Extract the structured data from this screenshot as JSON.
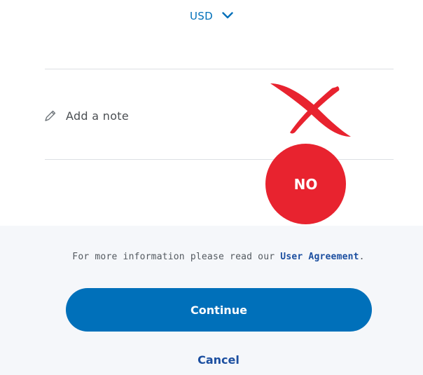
{
  "currency": {
    "code": "USD",
    "dropdown_icon": "chevron-down-icon"
  },
  "note": {
    "icon": "pencil-icon",
    "placeholder": "Add a note"
  },
  "annotation": {
    "mark_icon": "red-x-mark",
    "badge_label": "NO",
    "color": "#e8232f"
  },
  "info": {
    "prefix": "For more information please read our ",
    "link": "User Agreement",
    "suffix": "."
  },
  "actions": {
    "continue_label": "Continue",
    "cancel_label": "Cancel"
  },
  "colors": {
    "brand_blue": "#0070ba",
    "link_blue": "#1c4fa0",
    "page_bg": "#f5f7fa"
  }
}
